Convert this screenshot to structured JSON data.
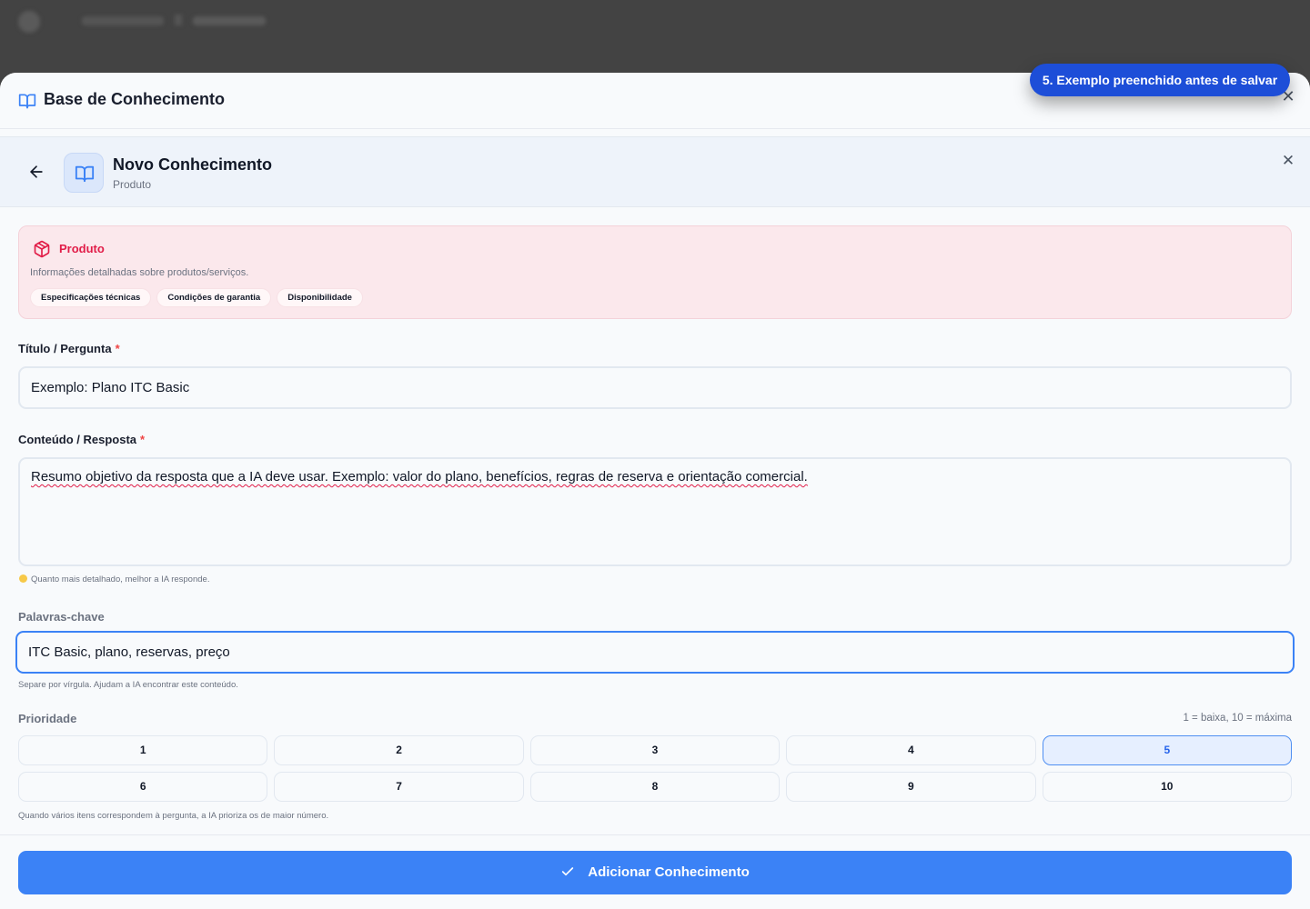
{
  "modal": {
    "title": "Base de Conhecimento",
    "close_icon": "close-icon",
    "subheader": {
      "title": "Novo Conhecimento",
      "caption": "Produto"
    }
  },
  "category": {
    "name": "Produto",
    "description": "Informações detalhadas sobre produtos/serviços.",
    "chips": [
      "Especificações técnicas",
      "Condições de garantia",
      "Disponibilidade"
    ],
    "color": "#e11d48"
  },
  "form": {
    "title_label": "Título / Pergunta",
    "title_value": "Exemplo: Plano ITC Basic",
    "content_label": "Conteúdo / Resposta",
    "content_value": "Resumo objetivo da resposta que a IA deve usar. Exemplo: valor do plano, benefícios, regras de reserva e orientação comercial.",
    "content_hint": "Quanto mais detalhado, melhor a IA responde.",
    "keywords_label": "Palavras-chave",
    "keywords_value": "ITC Basic, plano, reservas, preço",
    "keywords_hint": "Separe por vírgula. Ajudam a IA encontrar este conteúdo.",
    "priority_label": "Prioridade",
    "priority_scale": "1 = baixa, 10 = máxima",
    "priority_options": [
      "1",
      "2",
      "3",
      "4",
      "5",
      "6",
      "7",
      "8",
      "9",
      "10"
    ],
    "priority_selected": 5,
    "priority_hint": "Quando vários itens correspondem à pergunta, a IA prioriza os de maior número.",
    "required_mark": "*"
  },
  "submit_label": "Adicionar Conhecimento",
  "tooltip": "5. Exemplo preenchido antes de salvar",
  "colors": {
    "accent": "#3b82f6",
    "tooltip": "#1d4ed8",
    "category_bg": "#fbe8ec"
  }
}
